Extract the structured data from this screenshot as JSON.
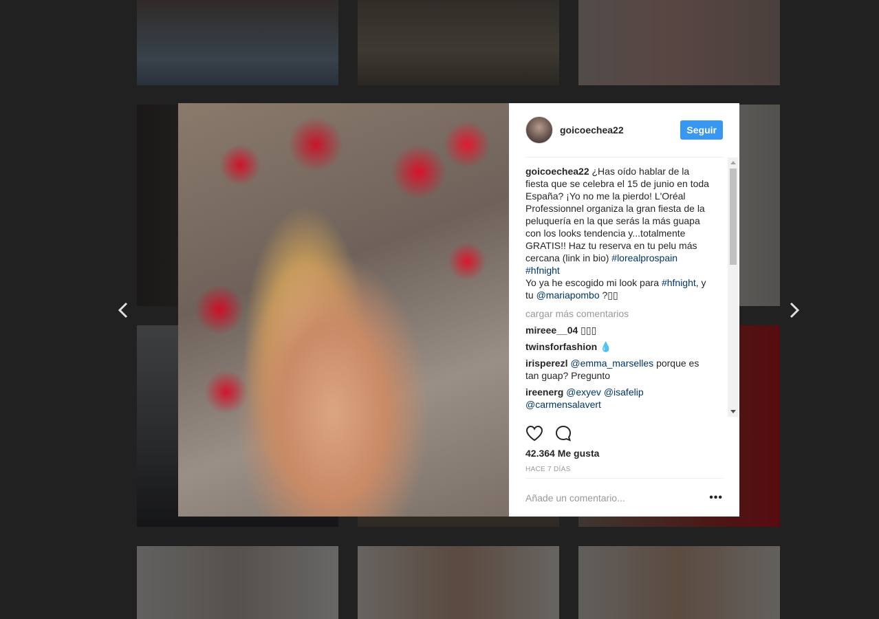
{
  "post": {
    "username": "goicoechea22",
    "follow_label": "Seguir",
    "caption_user": "goicoechea22",
    "caption_text_1": " ¿Has oído hablar de la fiesta que se celebra el 15 de junio en toda España? ¡Yo no me la pierdo! L'Oréal Professionnel organiza la gran fiesta de la peluquería en la que serás la más guapa con los looks tendencia y...totalmente GRATIS!! Haz tu reserva en tu pelu más cercana (link in bio) ",
    "caption_tag_1": "#lorealprospain",
    "caption_tag_2": "#hfnight",
    "caption_text_2": "Yo ya he escogido mi look para ",
    "caption_tag_3": "#hfnight",
    "caption_text_3": ", y tu ",
    "caption_mention": "@mariapombo",
    "caption_text_4": " ?▯▯",
    "load_more": "cargar más comentarios",
    "comments": [
      {
        "user": "mireee__04",
        "text": " ▯▯▯"
      },
      {
        "user": "twinsforfashion",
        "text": " 💧"
      },
      {
        "user": "irisperezl",
        "mention": "@emma_marselles",
        "text": " porque es tan guap? Pregunto"
      },
      {
        "user": "ireenerg",
        "mention": "@exyev @isafelip @carmensalavert",
        "text": ""
      }
    ],
    "likes": "42.364 Me gusta",
    "time": "HACE 7 DÍAS",
    "add_comment_placeholder": "Añade un comentario...",
    "more_options": "•••"
  },
  "icons": {
    "prev": "chevron-left-icon",
    "next": "chevron-right-icon",
    "like": "heart-icon",
    "comment": "comment-bubble-icon"
  }
}
